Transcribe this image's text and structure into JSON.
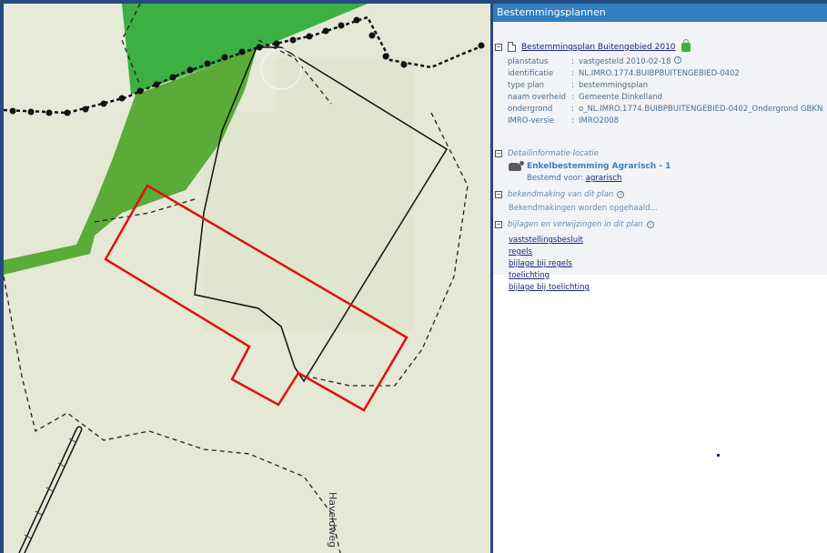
{
  "panel": {
    "title": "Bestemmingsplannen",
    "plan": {
      "toggle": "−",
      "title": "Bestemmingsplan Buitengebied 2010",
      "properties": [
        {
          "key": "planstatus",
          "value": "vastgesteld 2010-02-18"
        },
        {
          "key": "identificatie",
          "value": "NL.IMRO.1774.BUIBPBUITENGEBIED-0402"
        },
        {
          "key": "type plan",
          "value": "bestemmingsplan"
        },
        {
          "key": "naam overheid",
          "value": "Gemeente Dinkelland"
        },
        {
          "key": "ondergrond",
          "value": "o_NL.IMRO.1774.BUIBPBUITENGEBIED-0402_Ondergrond GBKN"
        },
        {
          "key": "IMRO-versie",
          "value": "IMRO2008"
        }
      ],
      "separator": ":"
    },
    "detail_section": {
      "toggle": "−",
      "label": "Detailinformatie locatie",
      "item_title": "Enkelbestemming Agrarisch - 1",
      "bestemd_label": "Bestemd voor:",
      "bestemd_link": "agrarisch"
    },
    "bekendmaking_section": {
      "toggle": "−",
      "label": "bekendmaking van dit plan",
      "status": "Bekendmakingen worden opgehaald..."
    },
    "bijlagen_section": {
      "toggle": "−",
      "label": "bijlagen en verwijzingen in dit plan",
      "links": [
        "vaststellingsbesluit",
        "regels",
        "bijlage bij regels",
        "toelichting",
        "bijlage bij toelichting"
      ]
    },
    "info_glyph": "i"
  },
  "map": {
    "street_label": "Haveldweg",
    "colors": {
      "background": "#e4e8d5",
      "green_bright": "#3cb043",
      "green_dark": "#4a9a2e",
      "selection": "#e01010",
      "boundary": "#111111"
    }
  }
}
